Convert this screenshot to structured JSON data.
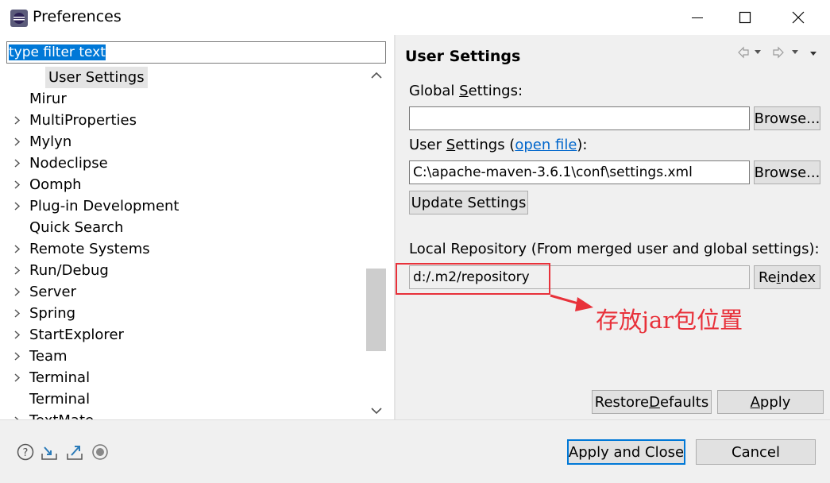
{
  "window": {
    "title": "Preferences",
    "minimize_icon": "minimize-icon",
    "maximize_icon": "maximize-icon",
    "close_icon": "close-icon"
  },
  "filter": {
    "value": "type filter text"
  },
  "tree": {
    "items": [
      {
        "label": "User Settings",
        "expandable": false,
        "child": true
      },
      {
        "label": "Mirur",
        "expandable": false,
        "child": false
      },
      {
        "label": "MultiProperties",
        "expandable": true,
        "child": false
      },
      {
        "label": "Mylyn",
        "expandable": true,
        "child": false
      },
      {
        "label": "Nodeclipse",
        "expandable": true,
        "child": false
      },
      {
        "label": "Oomph",
        "expandable": true,
        "child": false
      },
      {
        "label": "Plug-in Development",
        "expandable": true,
        "child": false
      },
      {
        "label": "Quick Search",
        "expandable": false,
        "child": false
      },
      {
        "label": "Remote Systems",
        "expandable": true,
        "child": false
      },
      {
        "label": "Run/Debug",
        "expandable": true,
        "child": false
      },
      {
        "label": "Server",
        "expandable": true,
        "child": false
      },
      {
        "label": "Spring",
        "expandable": true,
        "child": false
      },
      {
        "label": "StartExplorer",
        "expandable": true,
        "child": false
      },
      {
        "label": "Team",
        "expandable": true,
        "child": false
      },
      {
        "label": "Terminal",
        "expandable": true,
        "child": false
      },
      {
        "label": "Terminal",
        "expandable": false,
        "child": false
      },
      {
        "label": "TextMate",
        "expandable": true,
        "child": false
      }
    ]
  },
  "page": {
    "title": "User Settings",
    "global_settings": {
      "label_pre": "Global ",
      "label_mnemonic": "S",
      "label_post": "ettings:",
      "value": "",
      "browse_label": "Browse..."
    },
    "user_settings": {
      "label_pre": "User ",
      "label_mnemonic": "S",
      "label_post": "ettings (",
      "link_text": "open file",
      "label_end": "):",
      "value": "C:\\apache-maven-3.6.1\\conf\\settings.xml",
      "browse_label": "Browse..."
    },
    "update_settings_label": "Update Settings",
    "local_repository": {
      "label": "Local Repository (From merged user and global settings):",
      "value": "d:/.m2/repository",
      "reindex_pre": "Re",
      "reindex_mnemonic": "i",
      "reindex_post": "ndex"
    },
    "restore_defaults": {
      "pre": "Restore ",
      "mnemonic": "D",
      "post": "efaults"
    },
    "apply": {
      "mnemonic": "A",
      "post": "pply"
    }
  },
  "annotation": {
    "text": "存放jar包位置",
    "color": "#e8313a"
  },
  "footer": {
    "apply_and_close_label": "Apply and Close",
    "cancel_label": "Cancel"
  },
  "colors": {
    "selection": "#0078d7",
    "link": "#0066cc",
    "annotation": "#e8313a"
  }
}
